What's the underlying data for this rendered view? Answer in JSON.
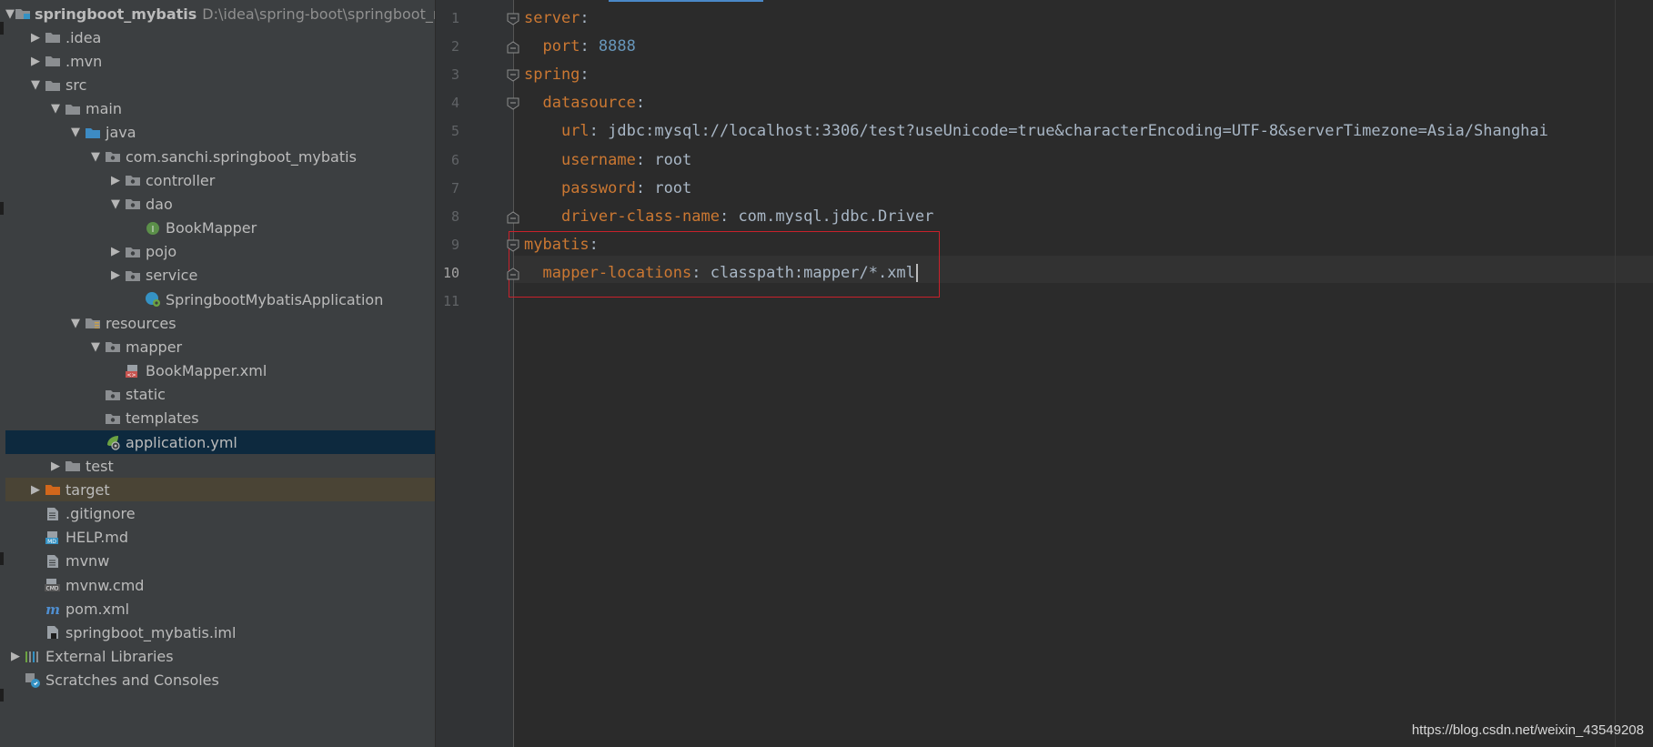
{
  "project_tree": [
    {
      "label": "springboot_mybatis",
      "path": "D:\\idea\\spring-boot\\springboot_myb",
      "bold": true,
      "depth": 0,
      "arrow": "down",
      "icon": "module-folder-icon"
    },
    {
      "label": ".idea",
      "depth": 1,
      "arrow": "right",
      "icon": "folder-icon"
    },
    {
      "label": ".mvn",
      "depth": 1,
      "arrow": "right",
      "icon": "folder-icon"
    },
    {
      "label": "src",
      "depth": 1,
      "arrow": "down",
      "icon": "folder-icon"
    },
    {
      "label": "main",
      "depth": 2,
      "arrow": "down",
      "icon": "folder-icon"
    },
    {
      "label": "java",
      "depth": 3,
      "arrow": "down",
      "icon": "source-folder-icon"
    },
    {
      "label": "com.sanchi.springboot_mybatis",
      "depth": 4,
      "arrow": "down",
      "icon": "package-icon"
    },
    {
      "label": "controller",
      "depth": 5,
      "arrow": "right",
      "icon": "package-icon"
    },
    {
      "label": "dao",
      "depth": 5,
      "arrow": "down",
      "icon": "package-icon"
    },
    {
      "label": "BookMapper",
      "depth": 6,
      "arrow": "none",
      "icon": "interface-icon"
    },
    {
      "label": "pojo",
      "depth": 5,
      "arrow": "right",
      "icon": "package-icon"
    },
    {
      "label": "service",
      "depth": 5,
      "arrow": "right",
      "icon": "package-icon"
    },
    {
      "label": "SpringbootMybatisApplication",
      "depth": 6,
      "arrow": "none",
      "icon": "spring-class-icon"
    },
    {
      "label": "resources",
      "depth": 3,
      "arrow": "down",
      "icon": "resources-folder-icon"
    },
    {
      "label": "mapper",
      "depth": 4,
      "arrow": "down",
      "icon": "package-icon"
    },
    {
      "label": "BookMapper.xml",
      "depth": 5,
      "arrow": "none",
      "icon": "xml-file-icon"
    },
    {
      "label": "static",
      "depth": 4,
      "arrow": "none",
      "icon": "package-icon"
    },
    {
      "label": "templates",
      "depth": 4,
      "arrow": "none",
      "icon": "package-icon"
    },
    {
      "label": "application.yml",
      "depth": 4,
      "arrow": "none",
      "icon": "spring-yml-icon",
      "selected": true
    },
    {
      "label": "test",
      "depth": 2,
      "arrow": "right",
      "icon": "folder-icon"
    },
    {
      "label": "target",
      "depth": 1,
      "arrow": "right",
      "icon": "excluded-folder-icon",
      "excluded": true
    },
    {
      "label": ".gitignore",
      "depth": 1,
      "arrow": "none",
      "icon": "text-file-icon"
    },
    {
      "label": "HELP.md",
      "depth": 1,
      "arrow": "none",
      "icon": "markdown-file-icon"
    },
    {
      "label": "mvnw",
      "depth": 1,
      "arrow": "none",
      "icon": "text-file-icon"
    },
    {
      "label": "mvnw.cmd",
      "depth": 1,
      "arrow": "none",
      "icon": "cmd-file-icon"
    },
    {
      "label": "pom.xml",
      "depth": 1,
      "arrow": "none",
      "icon": "maven-icon"
    },
    {
      "label": "springboot_mybatis.iml",
      "depth": 1,
      "arrow": "none",
      "icon": "iml-file-icon"
    },
    {
      "label": "External Libraries",
      "depth": 0,
      "arrow": "right",
      "icon": "libraries-icon"
    },
    {
      "label": "Scratches and Consoles",
      "depth": 0,
      "arrow": "none",
      "icon": "scratches-icon"
    }
  ],
  "editor": {
    "current_line": 10,
    "lines": [
      {
        "n": "1",
        "tokens": [
          {
            "t": "server",
            "c": "k"
          },
          {
            "t": ":",
            "c": "p"
          }
        ]
      },
      {
        "n": "2",
        "tokens": [
          {
            "t": "  "
          },
          {
            "t": "port",
            "c": "k"
          },
          {
            "t": ": ",
            "c": "p"
          },
          {
            "t": "8888",
            "c": "n"
          }
        ]
      },
      {
        "n": "3",
        "tokens": [
          {
            "t": "spring",
            "c": "k"
          },
          {
            "t": ":",
            "c": "p"
          }
        ]
      },
      {
        "n": "4",
        "tokens": [
          {
            "t": "  "
          },
          {
            "t": "datasource",
            "c": "k"
          },
          {
            "t": ":",
            "c": "p"
          }
        ]
      },
      {
        "n": "5",
        "tokens": [
          {
            "t": "    "
          },
          {
            "t": "url",
            "c": "k"
          },
          {
            "t": ": ",
            "c": "p"
          },
          {
            "t": "jdbc:mysql://localhost:3306/test?useUnicode=true&characterEncoding=UTF-8&serverTimezone=Asia/Shanghai",
            "c": "v"
          }
        ]
      },
      {
        "n": "6",
        "tokens": [
          {
            "t": "    "
          },
          {
            "t": "username",
            "c": "k"
          },
          {
            "t": ": ",
            "c": "p"
          },
          {
            "t": "root",
            "c": "v"
          }
        ]
      },
      {
        "n": "7",
        "tokens": [
          {
            "t": "    "
          },
          {
            "t": "password",
            "c": "k"
          },
          {
            "t": ": ",
            "c": "p"
          },
          {
            "t": "root",
            "c": "v"
          }
        ]
      },
      {
        "n": "8",
        "tokens": [
          {
            "t": "    "
          },
          {
            "t": "driver-class-name",
            "c": "k"
          },
          {
            "t": ": ",
            "c": "p"
          },
          {
            "t": "com.mysql.jdbc.Driver",
            "c": "v"
          }
        ]
      },
      {
        "n": "9",
        "tokens": [
          {
            "t": "mybatis",
            "c": "k"
          },
          {
            "t": ":",
            "c": "p"
          }
        ]
      },
      {
        "n": "10",
        "tokens": [
          {
            "t": "  "
          },
          {
            "t": "mapper-locations",
            "c": "k"
          },
          {
            "t": ": ",
            "c": "p"
          },
          {
            "t": "classpath:mapper/*.xml",
            "c": "v"
          }
        ]
      },
      {
        "n": "11",
        "tokens": []
      }
    ],
    "fold_lines": [
      1,
      2,
      3,
      4,
      8,
      9,
      10
    ]
  },
  "watermark": "https://blog.csdn.net/weixin_43549208",
  "colors": {
    "key": "#cc7832",
    "number": "#6897bb",
    "value": "#a9b7c6",
    "selection": "#0d293e",
    "highlight_box": "#c8212b"
  }
}
